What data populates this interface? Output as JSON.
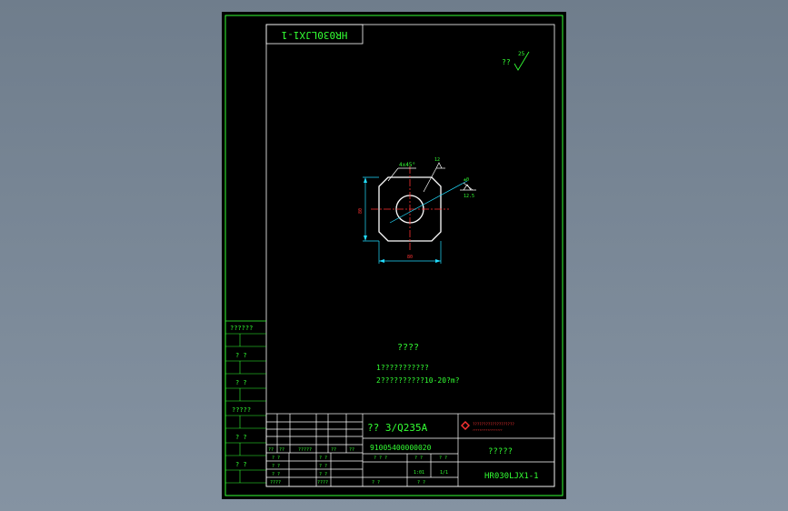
{
  "colors": {
    "frame": "#33ff33",
    "part": "#ffffff",
    "centerline": "#ff3333",
    "dimension": "#22ddff",
    "background": "#000000",
    "viewport": "#7c8a99"
  },
  "drawing_number_mirrored": "HR030LJX1-1",
  "roughness": {
    "symbol": "??",
    "value": "25"
  },
  "part_view": {
    "chamfer_label": "4x45°",
    "rough_top": "12",
    "rough_right": "12.5",
    "dim_width": "80",
    "dim_height": "80",
    "tolerance": "±0"
  },
  "notes": {
    "title": "????",
    "line1": "1???????????",
    "line2": "2??????????10-20?m?"
  },
  "side_labels": [
    "??????",
    "? ?",
    "? ?",
    "?????",
    "? ?",
    "? ?"
  ],
  "title_block": {
    "material": "?? 3/Q235A",
    "part_code": "91005400000020",
    "part_name": "?????",
    "drawing_no": "HR030LJX1-1",
    "company_line1": "???????????????????",
    "company_line2": "??????????????????",
    "header_row": [
      "??",
      "??",
      "?????",
      "??",
      "??"
    ],
    "left_rows": [
      "? ?",
      "? ?",
      "? ?",
      "????"
    ],
    "scale_row": [
      "? ? ?",
      "? ?",
      "? ?"
    ],
    "scale_vals": [
      "1:01",
      "1/1"
    ],
    "bottom_row": [
      "? ?",
      "? ?"
    ]
  }
}
